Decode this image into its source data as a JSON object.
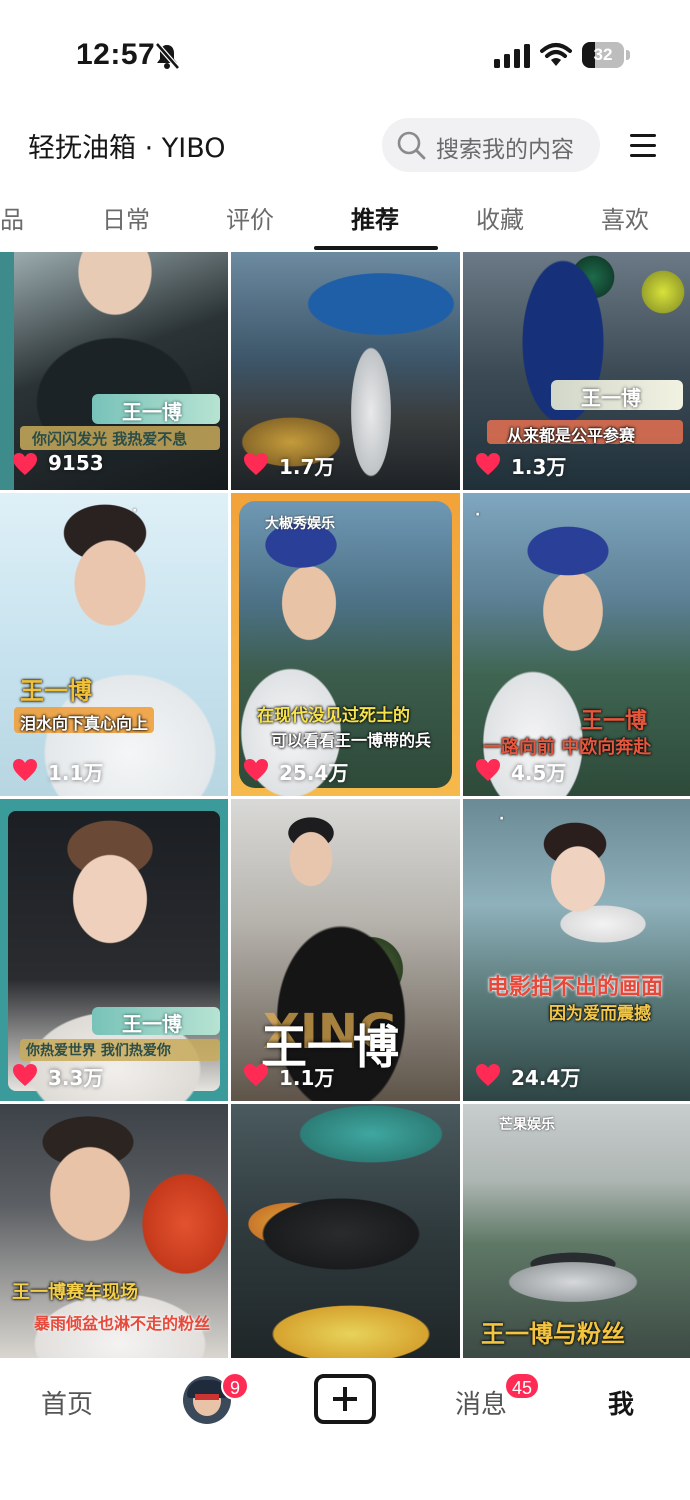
{
  "status_bar": {
    "time": "12:57",
    "battery": "32",
    "battery_level": 0.32,
    "icons": [
      "bell-muted-icon",
      "signal-icon",
      "wifi-icon",
      "battery-icon"
    ]
  },
  "header": {
    "title": "轻抚油箱 · YIBO",
    "search_placeholder": "搜索我的内容",
    "icons": [
      "search-icon",
      "menu-icon"
    ]
  },
  "tabs": [
    {
      "label": "品",
      "active": false
    },
    {
      "label": "日常",
      "active": false
    },
    {
      "label": "评价",
      "active": false
    },
    {
      "label": "推荐",
      "active": true
    },
    {
      "label": "收藏",
      "active": false
    },
    {
      "label": "喜欢",
      "active": false
    }
  ],
  "posts": [
    {
      "likes": "9153",
      "name_tag": "王一博",
      "caption": "你闪闪发光  我热爱不息"
    },
    {
      "likes": "1.7万"
    },
    {
      "likes": "1.3万",
      "name_tag": "王一博",
      "caption": "从来都是公平参赛"
    },
    {
      "likes": "1.1万",
      "name_tag": "王一博",
      "caption": "泪水向下真心向上"
    },
    {
      "likes": "25.4万",
      "watermark": "大椒秀娱乐",
      "caption": "在现代没见过死士的",
      "caption2": "可以看看王一博带的兵"
    },
    {
      "likes": "4.5万",
      "name_tag": "王一博",
      "caption": "一路向前 中欧向奔赴"
    },
    {
      "likes": "3.3万",
      "name_tag": "王一博",
      "caption": "你热爱世界  我们热爱你"
    },
    {
      "likes": "1.1万",
      "name_tag": "王一博"
    },
    {
      "likes": "24.4万",
      "caption": "电影拍不出的画面",
      "caption2": "因为爱而震撼"
    },
    {
      "caption": "王一博赛车现场",
      "caption2": "暴雨倾盆也淋不走的粉丝"
    },
    {},
    {
      "watermark": "芒果娱乐",
      "caption": "王一博与粉丝"
    }
  ],
  "bottom_nav": {
    "home": "首页",
    "avatar_badge": "9",
    "messages": "消息",
    "messages_badge": "45",
    "me": "我",
    "icons": [
      "avatar-icon",
      "create-plus-icon"
    ]
  },
  "colors": {
    "like_heart": "#ff2b55",
    "badge": "#ff2b55",
    "text_primary": "#161616",
    "search_bg": "#f1f1f3"
  }
}
